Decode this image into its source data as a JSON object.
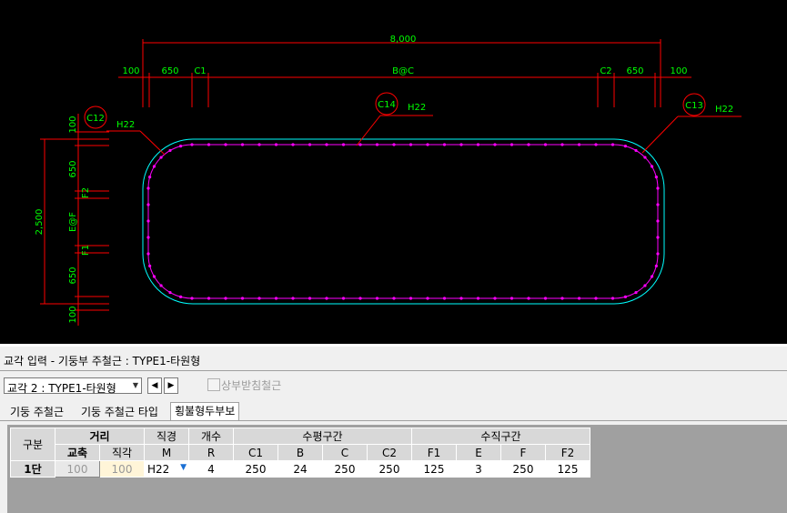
{
  "cad": {
    "total_width_label": "8,000",
    "dims_left": [
      "100",
      "650",
      "C1"
    ],
    "dims_center": "B@C",
    "dims_right": [
      "C2",
      "650",
      "100"
    ],
    "callout_left": {
      "tag": "C12",
      "label": "H22"
    },
    "callout_center": {
      "tag": "C14",
      "label": "H22"
    },
    "callout_right": {
      "tag": "C13",
      "label": "H22"
    },
    "vert_labels": [
      "100",
      "650",
      "F2",
      "E@F",
      "F1",
      "650",
      "100"
    ],
    "vert_total": "2,500",
    "colors": {
      "dim": "#ff0000",
      "text": "#00ff00",
      "outline": "#00ffff",
      "rebar": "#ff00ff",
      "leader": "#ff0000"
    }
  },
  "panel": {
    "title": "교각 입력 - 기둥부 주철근 : TYPE1-타원형",
    "combo_value": "교각 2 : TYPE1-타원형",
    "prev_icon": "◀",
    "next_icon": "▶",
    "checkbox_label": "상부받침철근",
    "tabs": [
      "기둥 주철근",
      "기둥 주철근 타입",
      "횡불형두부보"
    ]
  },
  "grid": {
    "h_group": "구분",
    "h_dist": "거리",
    "h_dia": "직경",
    "h_count": "개수",
    "h_horiz": "수평구간",
    "h_vert": "수직구간",
    "h_sub": [
      "교축",
      "직각",
      "M",
      "R",
      "C1",
      "B",
      "C",
      "C2",
      "F1",
      "E",
      "F",
      "F2"
    ],
    "row": {
      "label": "1단",
      "values": [
        "100",
        "100",
        "H22",
        "4",
        "250",
        "24",
        "250",
        "250",
        "125",
        "3",
        "250",
        "125"
      ]
    }
  }
}
